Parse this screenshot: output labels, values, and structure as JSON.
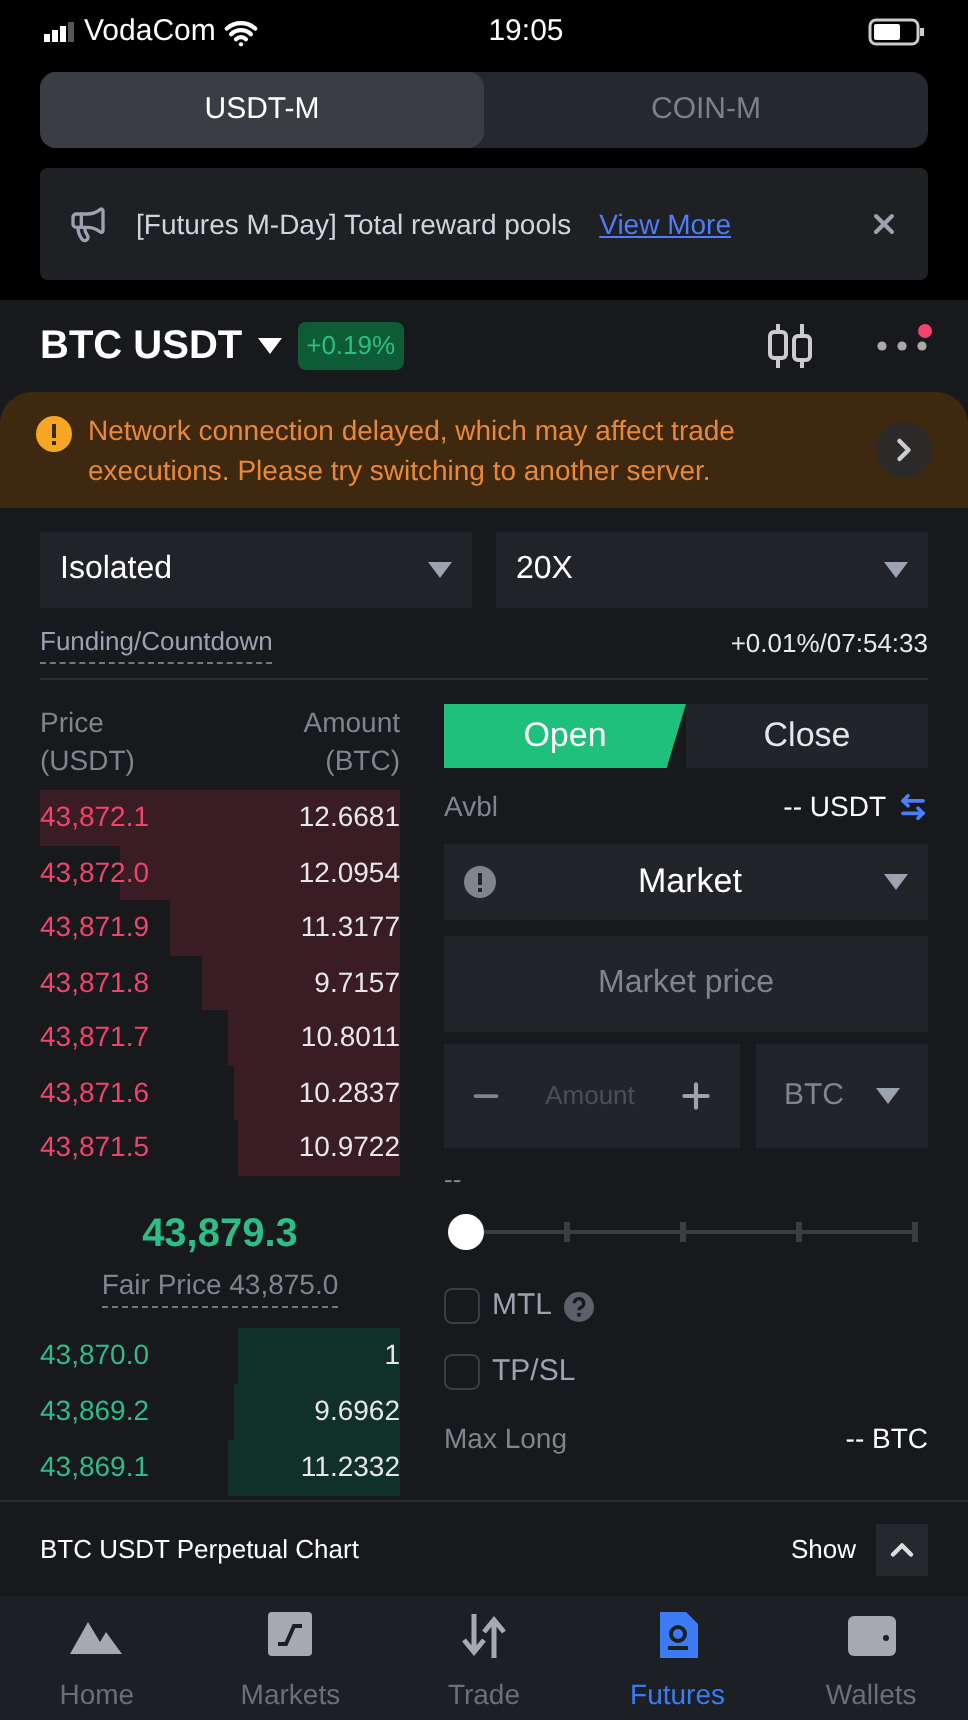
{
  "status_bar": {
    "carrier": "VodaCom",
    "time": "19:05"
  },
  "market_tabs": [
    {
      "label": "USDT-M",
      "selected": true
    },
    {
      "label": "COIN-M",
      "selected": false
    }
  ],
  "announcement": {
    "text": "[Futures M-Day] Total reward pools",
    "link": "View More"
  },
  "pair": {
    "symbol": "BTC USDT",
    "change": "+0.19%",
    "notification": true
  },
  "warning": {
    "text": "Network connection delayed, which may affect trade executions. Please try switching to another server."
  },
  "margin_mode": "Isolated",
  "leverage": "20X",
  "funding": {
    "label": "Funding/Countdown",
    "value": "+0.01%/07:54:33"
  },
  "order_book": {
    "price_header": "Price",
    "price_unit": "(USDT)",
    "amount_header": "Amount",
    "amount_unit": "(BTC)",
    "asks": [
      {
        "price": "43,872.1",
        "amount": "12.6681"
      },
      {
        "price": "43,872.0",
        "amount": "12.0954"
      },
      {
        "price": "43,871.9",
        "amount": "11.3177"
      },
      {
        "price": "43,871.8",
        "amount": "9.7157"
      },
      {
        "price": "43,871.7",
        "amount": "10.8011"
      },
      {
        "price": "43,871.6",
        "amount": "10.2837"
      },
      {
        "price": "43,871.5",
        "amount": "10.9722"
      }
    ],
    "last_price": "43,879.3",
    "fair_price": "Fair Price 43,875.0",
    "bids": [
      {
        "price": "43,870.0",
        "amount": "1"
      },
      {
        "price": "43,869.2",
        "amount": "9.6962"
      },
      {
        "price": "43,869.1",
        "amount": "11.2332"
      }
    ]
  },
  "order_form": {
    "sides": [
      {
        "label": "Open",
        "selected": true
      },
      {
        "label": "Close",
        "selected": false
      }
    ],
    "avbl_label": "Avbl",
    "avbl_value": "-- USDT",
    "order_type": "Market",
    "price_placeholder": "Market price",
    "amount_placeholder": "Amount",
    "amount_unit": "BTC",
    "cost": "--",
    "slider": {
      "level": 0
    },
    "options": [
      {
        "label": "MTL",
        "checked": false,
        "help": true
      },
      {
        "label": "TP/SL",
        "checked": false,
        "help": false
      }
    ],
    "max_long_label": "Max Long",
    "max_long_value": "-- BTC"
  },
  "chart_bar": {
    "title": "BTC USDT Perpetual Chart",
    "toggle": "Show"
  },
  "nav": [
    {
      "label": "Home",
      "selected": false
    },
    {
      "label": "Markets",
      "selected": false
    },
    {
      "label": "Trade",
      "selected": false
    },
    {
      "label": "Futures",
      "selected": true
    },
    {
      "label": "Wallets",
      "selected": false
    }
  ]
}
